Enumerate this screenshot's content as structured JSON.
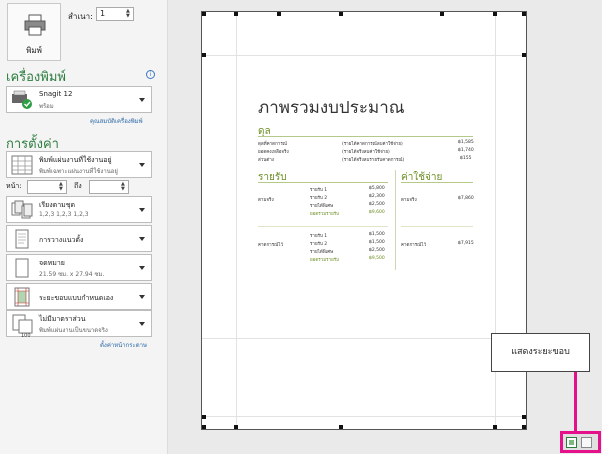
{
  "print_button": {
    "label": "พิมพ์"
  },
  "copies": {
    "label": "สำเนา:",
    "value": "1"
  },
  "printer_section": {
    "title": "เครื่องพิมพ์",
    "info_icon": "i",
    "printer_name": "Snagit 12",
    "printer_status": "พร้อม",
    "properties_link": "คุณสมบัติเครื่องพิมพ์"
  },
  "settings_section": {
    "title": "การตั้งค่า",
    "print_what": {
      "title": "พิมพ์แผ่นงานที่ใช้งานอยู่",
      "subtitle": "พิมพ์เฉพาะแผ่นงานที่ใช้งานอยู่"
    },
    "pages": {
      "label": "หน้า:",
      "to_label": "ถึง"
    },
    "collate": {
      "title": "เรียงตามชุด",
      "subtitle": "1,2,3    1,2,3    1,2,3"
    },
    "orientation": {
      "title": "การวางแนวตั้ง"
    },
    "paper": {
      "title": "จดหมาย",
      "subtitle": "21.59 ซม. x 27.94 ซม."
    },
    "margins": {
      "title": "ระยะขอบแบบกำหนดเอง"
    },
    "scaling": {
      "title": "ไม่มีมาตราส่วน",
      "subtitle": "พิมพ์แผ่นงานเป็นขนาดจริง",
      "badge": "100"
    },
    "page_setup_link": "ตั้งค่าหน้ากระดาษ"
  },
  "preview_doc": {
    "title": "ภาพรวมงบประมาณ",
    "summary_heading": "ดุล",
    "summary_rows": [
      {
        "label": "ดุลที่คาดการณ์",
        "desc": "(รายได้คาดการณ์ลบค่าใช้จ่าย)",
        "value": "฿1,585"
      },
      {
        "label": "ยอดคงเหลือจริง",
        "desc": "(รายได้จริงลบค่าใช้จ่าย)",
        "value": "฿1,740"
      },
      {
        "label": "ส่วนต่าง",
        "desc": "(รายได้จริงลบรายรับคาดการณ์)",
        "value": "฿155"
      }
    ],
    "income_heading": "รายรับ",
    "expense_heading": "ค่าใช้จ่าย",
    "actual_income_label": "ตามจริง",
    "actual_income_rows": [
      {
        "label": "รายรับ 1",
        "value": "฿5,800"
      },
      {
        "label": "รายรับ 2",
        "value": "฿2,300"
      },
      {
        "label": "รายได้พิเศษ",
        "value": "฿2,500"
      },
      {
        "label": "ยอดรวมรายรับ",
        "value": "฿9,600"
      }
    ],
    "projected_income_label": "คาดการณ์ไว้",
    "projected_income_rows": [
      {
        "label": "รายรับ 1",
        "value": "฿1,500"
      },
      {
        "label": "รายรับ 2",
        "value": "฿1,500"
      },
      {
        "label": "รายได้พิเศษ",
        "value": "฿2,500"
      },
      {
        "label": "ยอดรวมรายรับ",
        "value": "฿9,500"
      }
    ],
    "expense_actual": {
      "label": "ตามจริง",
      "value": "฿7,860"
    },
    "expense_projected": {
      "label": "คาดการณ์ไว้",
      "value": "฿7,915"
    }
  },
  "callout": {
    "text": "แสดงระยะขอบ"
  },
  "accent_colors": {
    "highlight": "#e5118a",
    "section_title": "#2e7d40",
    "doc_accent": "#6b8e23"
  }
}
